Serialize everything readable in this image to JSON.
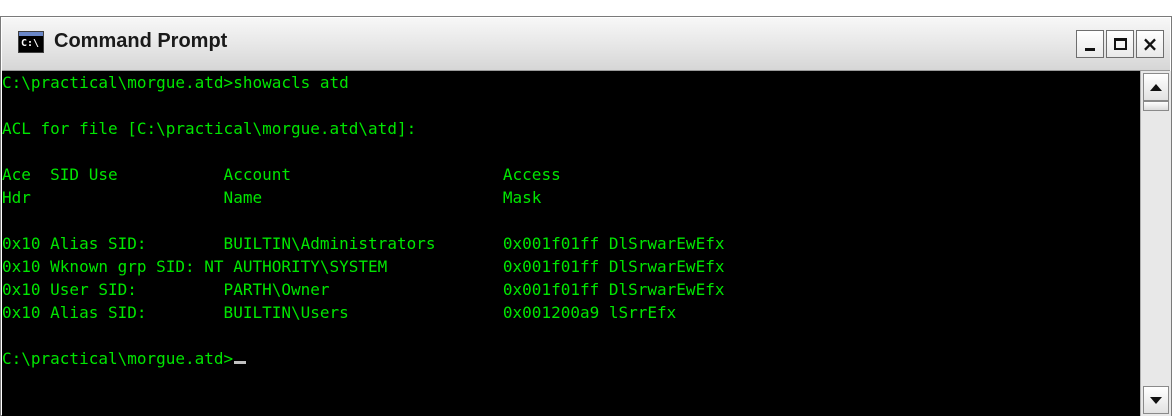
{
  "window": {
    "title": "Command Prompt",
    "icon": "cmd-window-icon",
    "icon_text": "C:\\"
  },
  "controls": {
    "minimize": "minimize-icon",
    "maximize": "maximize-icon",
    "close": "close-icon"
  },
  "console": {
    "text_color": "#00e600",
    "background": "#000000",
    "lines": [
      "C:\\practical\\morgue.atd>showacls atd",
      "",
      "ACL for file [C:\\practical\\morgue.atd\\atd]:",
      "",
      "Ace  SID Use           Account                      Access",
      "Hdr                    Name                         Mask",
      "",
      "0x10 Alias SID:        BUILTIN\\Administrators       0x001f01ff DlSrwarEwEfx",
      "0x10 Wknown grp SID: NT AUTHORITY\\SYSTEM            0x001f01ff DlSrwarEwEfx",
      "0x10 User SID:         PARTH\\Owner                  0x001f01ff DlSrwarEwEfx",
      "0x10 Alias SID:        BUILTIN\\Users                0x001200a9 lSrrEfx",
      "",
      "C:\\practical\\morgue.atd>"
    ]
  }
}
